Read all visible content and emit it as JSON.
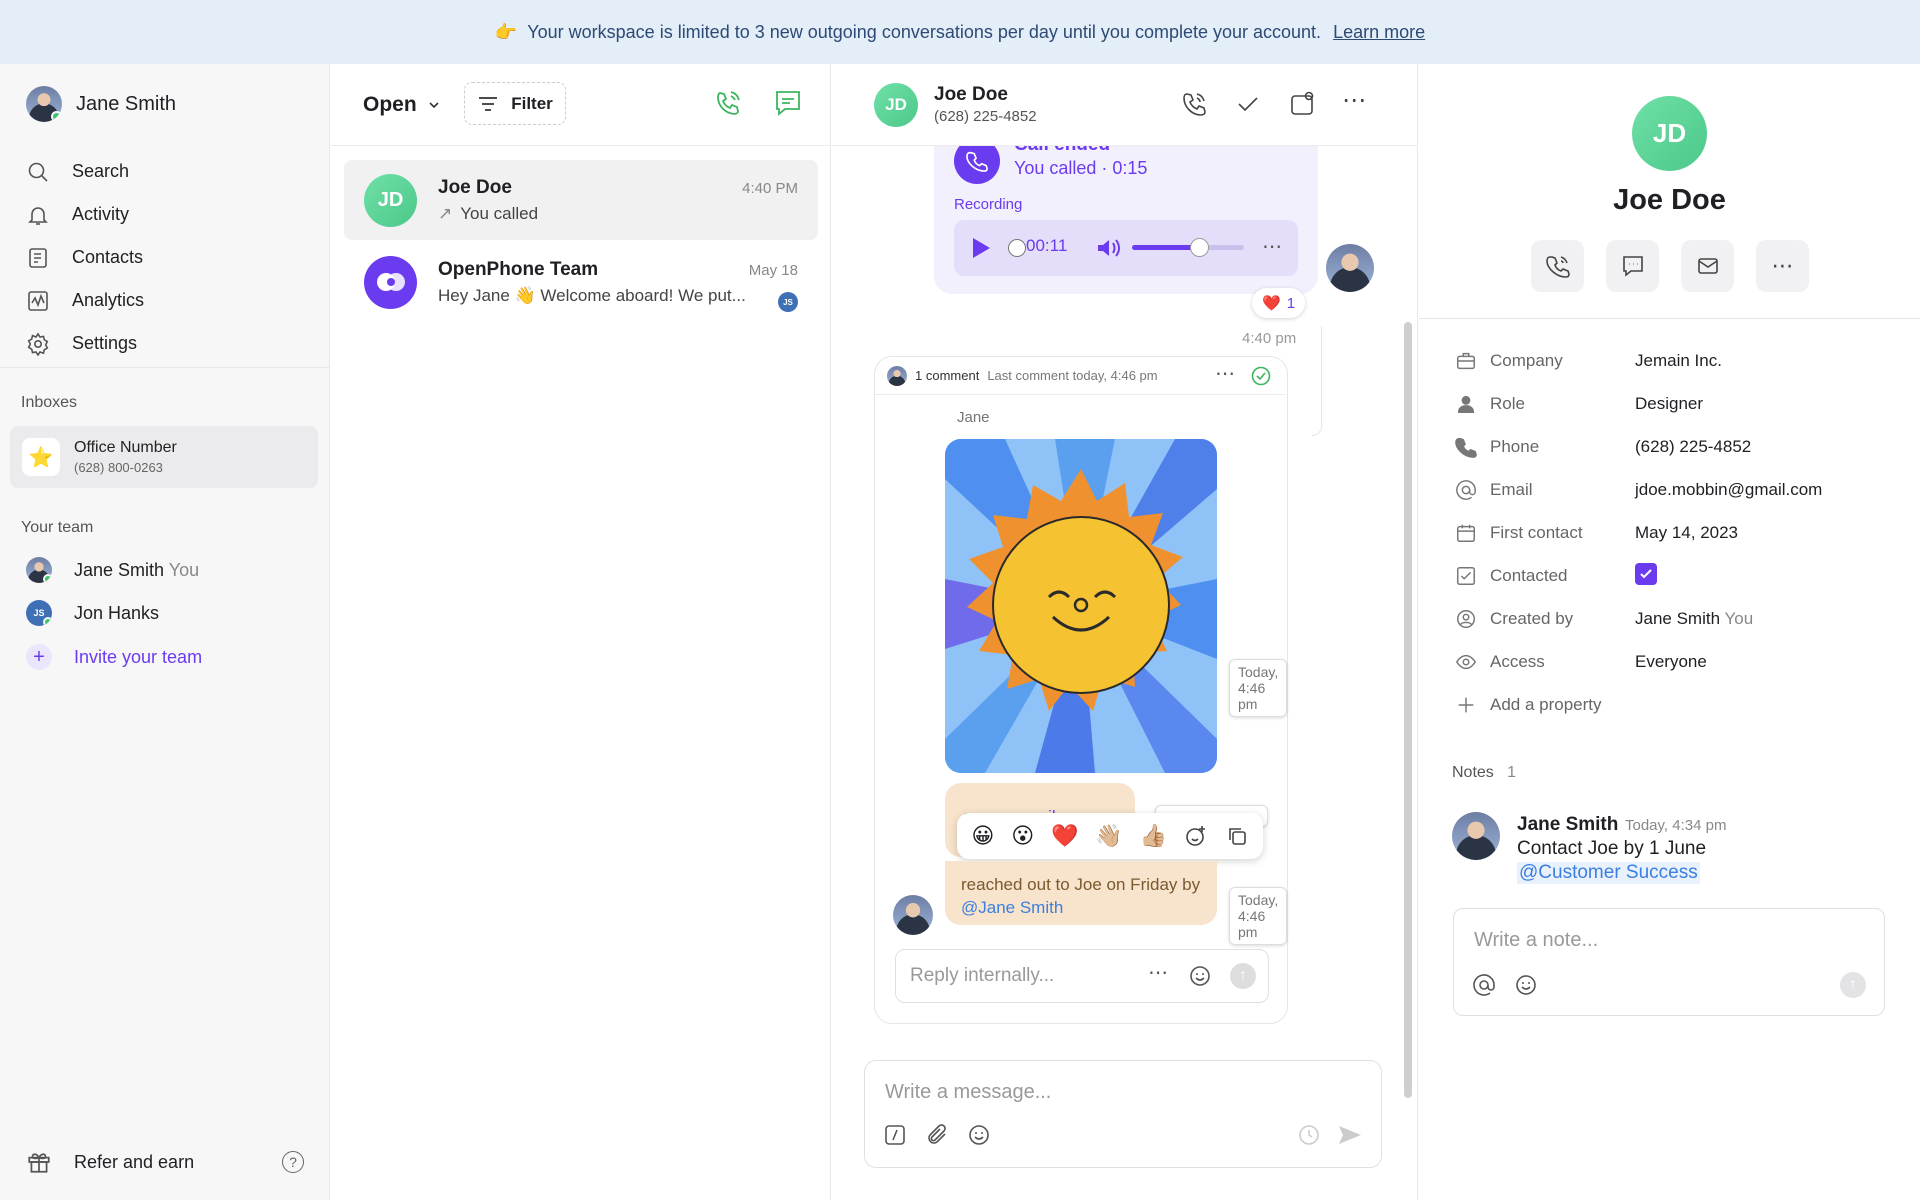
{
  "banner": {
    "emoji": "👉",
    "text": "Your workspace is limited to 3 new outgoing conversations per day until you complete your account.",
    "link": "Learn more"
  },
  "sidebar": {
    "user": "Jane Smith",
    "nav": [
      {
        "label": "Search",
        "icon": "search-icon"
      },
      {
        "label": "Activity",
        "icon": "bell-icon"
      },
      {
        "label": "Contacts",
        "icon": "contacts-icon"
      },
      {
        "label": "Analytics",
        "icon": "analytics-icon"
      },
      {
        "label": "Settings",
        "icon": "gear-icon"
      }
    ],
    "inboxes_label": "Inboxes",
    "inbox": {
      "name": "Office Number",
      "number": "(628) 800-0263",
      "icon": "⭐"
    },
    "team_label": "Your team",
    "team": [
      {
        "name": "Jane Smith",
        "tag": "You"
      },
      {
        "name": "Jon Hanks",
        "tag": "",
        "initials": "JS"
      }
    ],
    "invite": "Invite your team",
    "refer": "Refer and earn",
    "help": "?"
  },
  "list": {
    "status": "Open",
    "filter": "Filter",
    "conversations": [
      {
        "initials": "JD",
        "name": "Joe Doe",
        "preview": "You called",
        "time": "4:40 PM"
      },
      {
        "name": "OpenPhone Team",
        "preview": "Hey Jane 👋 Welcome aboard! We put...",
        "time": "May 18",
        "badge": "JS"
      }
    ]
  },
  "thread": {
    "initials": "JD",
    "name": "Joe Doe",
    "phone": "(628) 225-4852",
    "call": {
      "title": "Call ended",
      "sub": "You called · 0:15",
      "recording_label": "Recording",
      "elapsed": "00:11",
      "progress": 0.6
    },
    "reaction": {
      "emoji": "❤️",
      "count": "1"
    },
    "call_time": "4:40 pm",
    "comments": {
      "count": "1 comment",
      "last": "Last comment today, 4:46 pm",
      "author": "Jane",
      "file": "email.csv",
      "text_prefix": "reached out to Joe on Friday by ",
      "mention": "@Jane Smith",
      "image_time": "Today, 4:46 pm",
      "file_time": "Today, 4:46 pm",
      "text_time": "Today, 4:46 pm",
      "reply_placeholder": "Reply internally..."
    },
    "reactions_bar": [
      "😀",
      "😮",
      "❤️",
      "👋🏼",
      "👍🏼"
    ],
    "compose_placeholder": "Write a message..."
  },
  "contact": {
    "initials": "JD",
    "name": "Joe Doe",
    "props": [
      {
        "label": "Company",
        "value": "Jemain Inc."
      },
      {
        "label": "Role",
        "value": "Designer"
      },
      {
        "label": "Phone",
        "value": "(628) 225-4852"
      },
      {
        "label": "Email",
        "value": "jdoe.mobbin@gmail.com"
      },
      {
        "label": "First contact",
        "value": "May 14, 2023"
      },
      {
        "label": "Contacted",
        "value": ""
      },
      {
        "label": "Created by",
        "value": "Jane Smith",
        "tag": "You"
      },
      {
        "label": "Access",
        "value": "Everyone"
      }
    ],
    "add_property": "Add a property",
    "notes_label": "Notes",
    "notes_count": "1",
    "note": {
      "author": "Jane Smith",
      "time": "Today, 4:34 pm",
      "text": "Contact Joe by 1 June",
      "mention": "@Customer Success"
    },
    "note_placeholder": "Write a note..."
  },
  "colors": {
    "accent": "#6b3bf0",
    "green": "#3cc36b",
    "banner": "#e4eef9"
  }
}
